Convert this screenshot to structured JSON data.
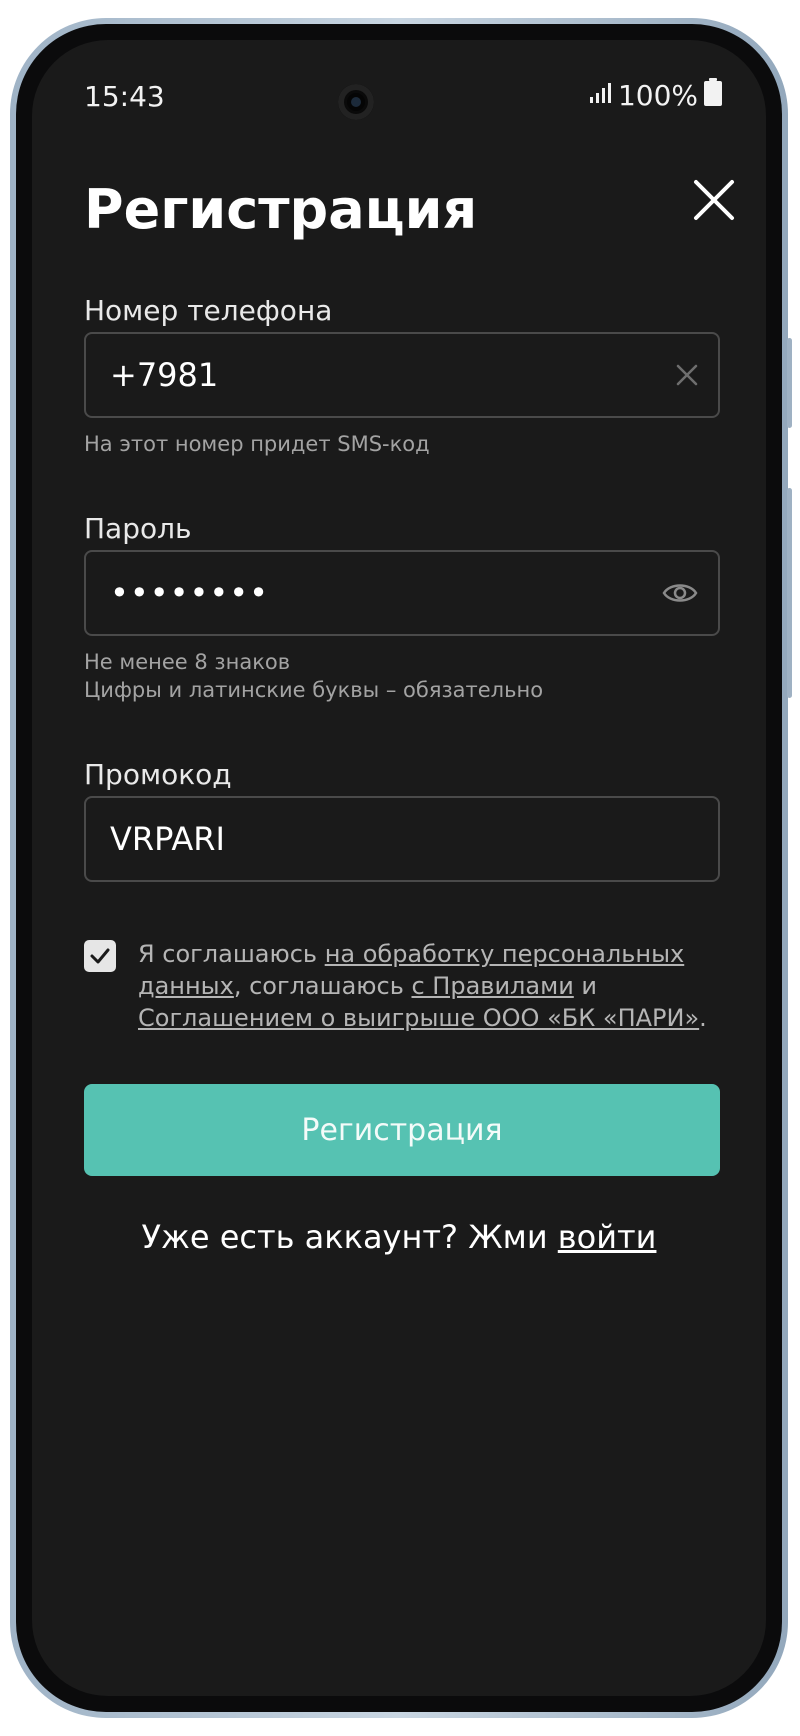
{
  "status_bar": {
    "time": "15:43",
    "battery": "100%",
    "icons": [
      "signal-icon",
      "battery-icon",
      "front-camera"
    ]
  },
  "header": {
    "title": "Регистрация",
    "close_icon": "close-icon"
  },
  "phone": {
    "label": "Номер телефона",
    "value": "+7981",
    "helper": "На этот номер придет SMS-код",
    "clear_icon": "clear-icon"
  },
  "password": {
    "label": "Пароль",
    "value": "••••••••",
    "helper_line1": "Не менее 8 знаков",
    "helper_line2": "Цифры и латинские буквы – обязательно",
    "toggle_icon": "eye-icon"
  },
  "promo": {
    "label": "Промокод",
    "value": "VRPARI"
  },
  "consent": {
    "checked": true,
    "text_1": "Я соглашаюсь ",
    "link_1": "на обработку персональных данных",
    "text_2": ", соглашаюсь ",
    "link_2": "с Правилами",
    "text_3": " и ",
    "link_3": "Соглашением о выигрыше ООО «БК «ПАРИ»",
    "text_4": "."
  },
  "submit_label": "Регистрация",
  "login": {
    "prompt": "Уже есть аккаунт? Жми ",
    "link": "войти"
  },
  "colors": {
    "background": "#1a1a1a",
    "accent": "#56c2b2",
    "input_border": "#4a4a4a",
    "helper_text": "#a3a3a3"
  }
}
